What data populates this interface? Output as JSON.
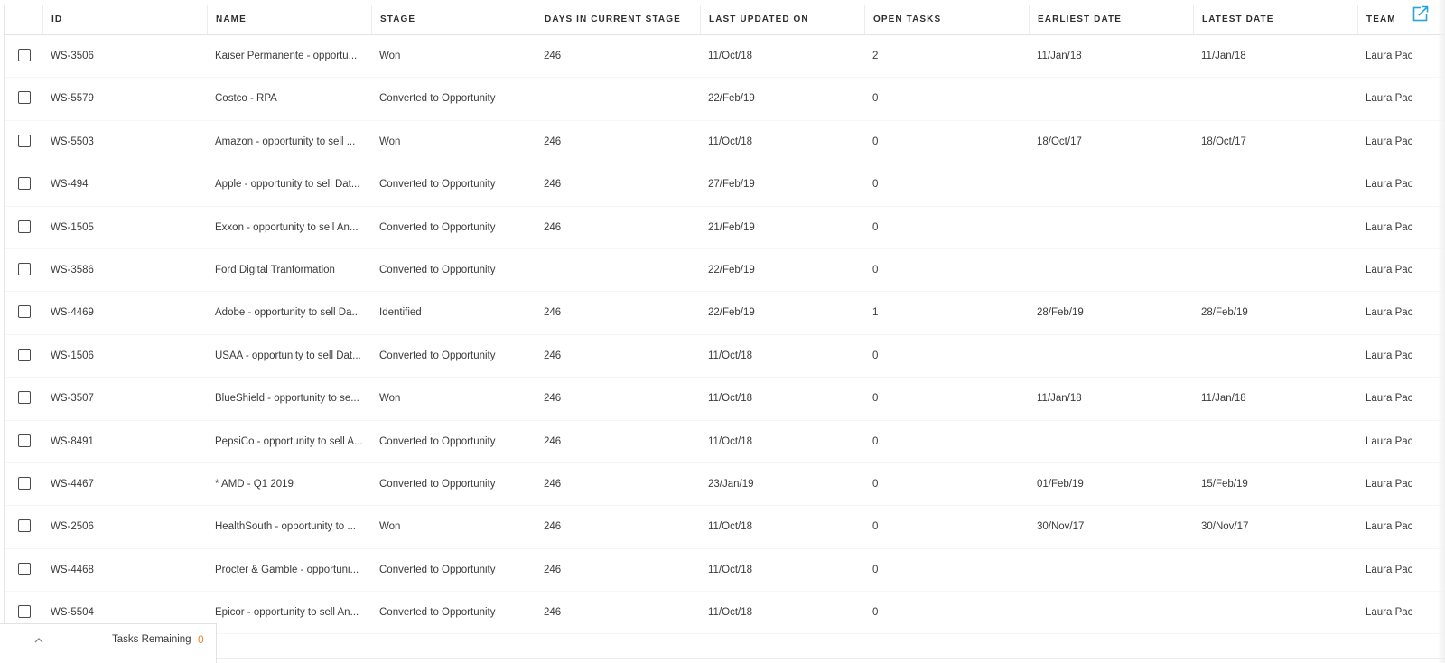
{
  "colors": {
    "accent": "#29a3dc",
    "tasks_count": "#e8812e",
    "text": "#3b3b3b",
    "header_text": "#2e2e2e"
  },
  "table": {
    "columns": [
      {
        "key": "id",
        "label": "ID"
      },
      {
        "key": "name",
        "label": "NAME"
      },
      {
        "key": "stage",
        "label": "STAGE"
      },
      {
        "key": "days",
        "label": "DAYS IN CURRENT STAGE"
      },
      {
        "key": "updated",
        "label": "LAST UPDATED ON"
      },
      {
        "key": "tasks",
        "label": "OPEN TASKS"
      },
      {
        "key": "earliest",
        "label": "EARLIEST DATE"
      },
      {
        "key": "latest",
        "label": "LATEST DATE"
      },
      {
        "key": "team",
        "label": "TEAM"
      }
    ],
    "rows": [
      {
        "id": "WS-3506",
        "name": "Kaiser Permanente - opportu...",
        "stage": "Won",
        "days": "246",
        "updated": "11/Oct/18",
        "tasks": "2",
        "earliest": "11/Jan/18",
        "latest": "11/Jan/18",
        "team": "Laura Pac"
      },
      {
        "id": "WS-5579",
        "name": "Costco - RPA",
        "stage": "Converted to Opportunity",
        "days": "",
        "updated": "22/Feb/19",
        "tasks": "0",
        "earliest": "",
        "latest": "",
        "team": "Laura Pac"
      },
      {
        "id": "WS-5503",
        "name": "Amazon - opportunity to sell ...",
        "stage": "Won",
        "days": "246",
        "updated": "11/Oct/18",
        "tasks": "0",
        "earliest": "18/Oct/17",
        "latest": "18/Oct/17",
        "team": "Laura Pac"
      },
      {
        "id": "WS-494",
        "name": "Apple - opportunity to sell Dat...",
        "stage": "Converted to Opportunity",
        "days": "246",
        "updated": "27/Feb/19",
        "tasks": "0",
        "earliest": "",
        "latest": "",
        "team": "Laura Pac"
      },
      {
        "id": "WS-1505",
        "name": "Exxon - opportunity to sell An...",
        "stage": "Converted to Opportunity",
        "days": "246",
        "updated": "21/Feb/19",
        "tasks": "0",
        "earliest": "",
        "latest": "",
        "team": "Laura Pac"
      },
      {
        "id": "WS-3586",
        "name": "Ford Digital Tranformation",
        "stage": "Converted to Opportunity",
        "days": "",
        "updated": "22/Feb/19",
        "tasks": "0",
        "earliest": "",
        "latest": "",
        "team": "Laura Pac"
      },
      {
        "id": "WS-4469",
        "name": "Adobe - opportunity to sell Da...",
        "stage": "Identified",
        "days": "246",
        "updated": "22/Feb/19",
        "tasks": "1",
        "earliest": "28/Feb/19",
        "latest": "28/Feb/19",
        "team": "Laura Pac"
      },
      {
        "id": "WS-1506",
        "name": "USAA - opportunity to sell Dat...",
        "stage": "Converted to Opportunity",
        "days": "246",
        "updated": "11/Oct/18",
        "tasks": "0",
        "earliest": "",
        "latest": "",
        "team": "Laura Pac"
      },
      {
        "id": "WS-3507",
        "name": "BlueShield - opportunity to se...",
        "stage": "Won",
        "days": "246",
        "updated": "11/Oct/18",
        "tasks": "0",
        "earliest": "11/Jan/18",
        "latest": "11/Jan/18",
        "team": "Laura Pac"
      },
      {
        "id": "WS-8491",
        "name": "PepsiCo - opportunity to sell A...",
        "stage": "Converted to Opportunity",
        "days": "246",
        "updated": "11/Oct/18",
        "tasks": "0",
        "earliest": "",
        "latest": "",
        "team": "Laura Pac"
      },
      {
        "id": "WS-4467",
        "name": "* AMD - Q1 2019",
        "stage": "Converted to Opportunity",
        "days": "246",
        "updated": "23/Jan/19",
        "tasks": "0",
        "earliest": "01/Feb/19",
        "latest": "15/Feb/19",
        "team": "Laura Pac"
      },
      {
        "id": "WS-2506",
        "name": "HealthSouth - opportunity to ...",
        "stage": "Won",
        "days": "246",
        "updated": "11/Oct/18",
        "tasks": "0",
        "earliest": "30/Nov/17",
        "latest": "30/Nov/17",
        "team": "Laura Pac"
      },
      {
        "id": "WS-4468",
        "name": "Procter & Gamble - opportuni...",
        "stage": "Converted to Opportunity",
        "days": "246",
        "updated": "11/Oct/18",
        "tasks": "0",
        "earliest": "",
        "latest": "",
        "team": "Laura Pac"
      },
      {
        "id": "WS-5504",
        "name": "Epicor - opportunity to sell An...",
        "stage": "Converted to Opportunity",
        "days": "246",
        "updated": "11/Oct/18",
        "tasks": "0",
        "earliest": "",
        "latest": "",
        "team": "Laura Pac"
      }
    ]
  },
  "icons": {
    "open_external": "open-in-new-icon",
    "expand": "chevron-up-icon"
  },
  "tasks_panel": {
    "label": "Tasks Remaining",
    "count": "0"
  }
}
